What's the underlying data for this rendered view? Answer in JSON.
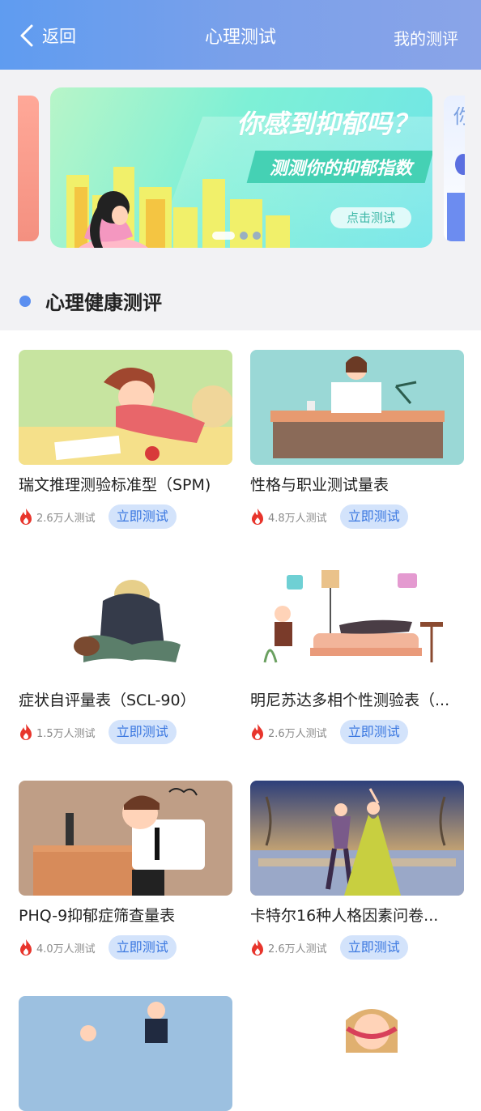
{
  "header": {
    "back_label": "返回",
    "title": "心理测试",
    "my_tests": "我的测评"
  },
  "banner": {
    "headline": "你感到抑郁吗？",
    "subline": "测测你的抑郁指数",
    "button": "点击测试",
    "side_right_text": "你"
  },
  "section": {
    "title": "心理健康测评"
  },
  "tests": [
    {
      "name": "瑞文推理测验标准型（SPM)",
      "count": "2.6万人测试",
      "button": "立即测试"
    },
    {
      "name": "性格与职业测试量表",
      "count": "4.8万人测试",
      "button": "立即测试"
    },
    {
      "name": "症状自评量表（SCL-90）",
      "count": "1.5万人测试",
      "button": "立即测试"
    },
    {
      "name": "明尼苏达多相个性测验表（...",
      "count": "2.6万人测试",
      "button": "立即测试"
    },
    {
      "name": "PHQ-9抑郁症筛查量表",
      "count": "4.0万人测试",
      "button": "立即测试"
    },
    {
      "name": "卡特尔16种人格因素问卷...",
      "count": "2.6万人测试",
      "button": "立即测试"
    }
  ],
  "colors": {
    "header_gradient_start": "#5f9cf0",
    "header_gradient_end": "#8aa4e8",
    "accent_blue": "#3a77e0",
    "button_bg": "#d3e3fb",
    "fire_red": "#e8352c"
  }
}
